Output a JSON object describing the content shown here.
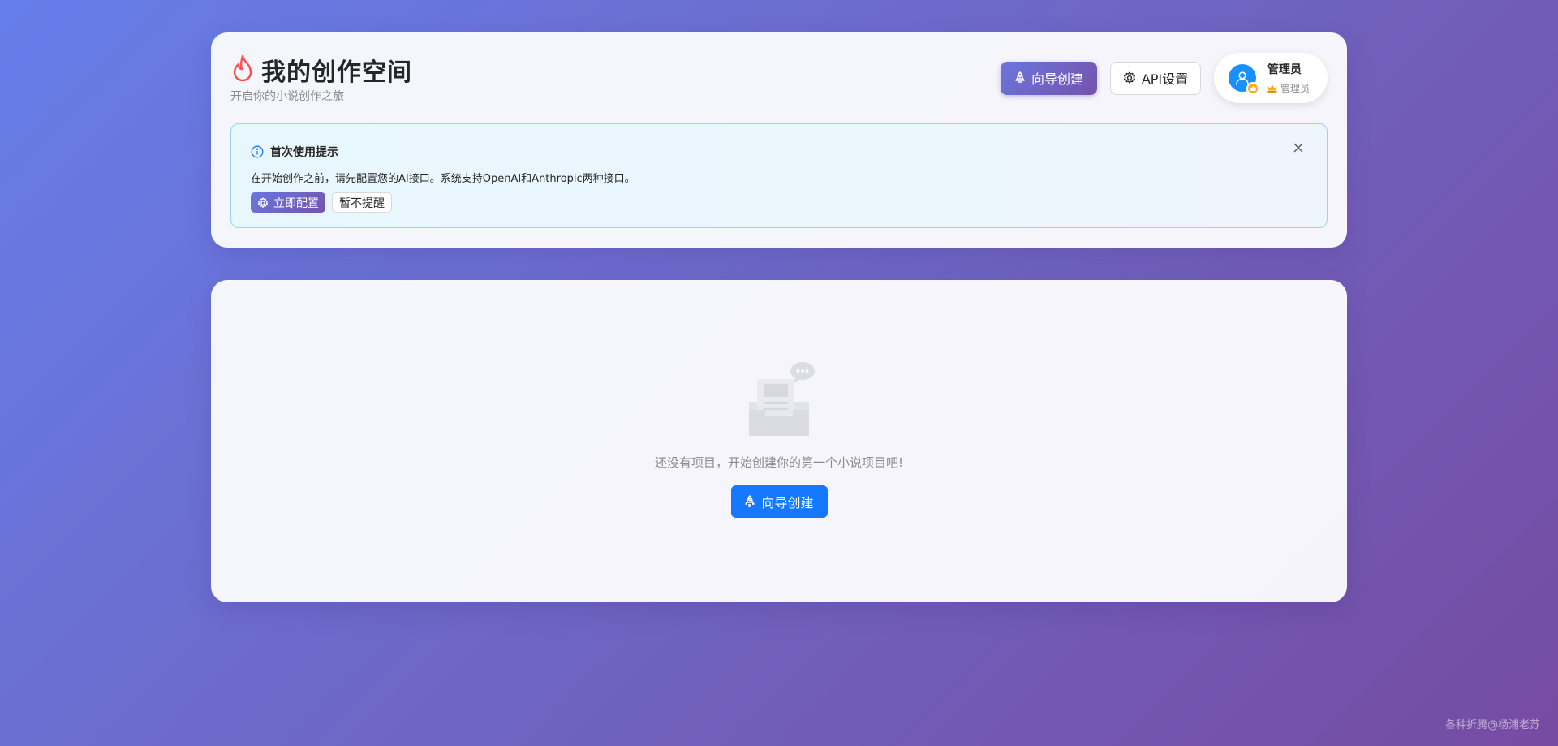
{
  "header": {
    "title": "我的创作空间",
    "subtitle": "开启你的小说创作之旅",
    "wizard_label": "向导创建",
    "api_label": "API设置",
    "user": {
      "name": "管理员",
      "role": "管理员"
    }
  },
  "notice": {
    "title": "首次使用提示",
    "text": "在开始创作之前，请先配置您的AI接口。系统支持OpenAI和Anthropic两种接口。",
    "config_label": "立即配置",
    "dismiss_label": "暂不提醒"
  },
  "empty": {
    "text": "还没有项目，开始创建你的第一个小说项目吧!",
    "button_label": "向导创建"
  },
  "watermark": "各种折腾@杨浦老苏",
  "colors": {
    "accent_gradient_start": "#667eea",
    "accent_gradient_end": "#764ba2",
    "primary_blue": "#1677ff",
    "notice_border": "#91d5ff",
    "fire": "#ff4d4f",
    "crown": "#faad14"
  },
  "icons": {
    "title": "fire-icon",
    "wizard": "rocket-icon",
    "api": "gear-icon",
    "avatar": "user-icon",
    "notice": "info-circle-icon",
    "close": "close-icon",
    "empty": "empty-inbox-icon"
  }
}
